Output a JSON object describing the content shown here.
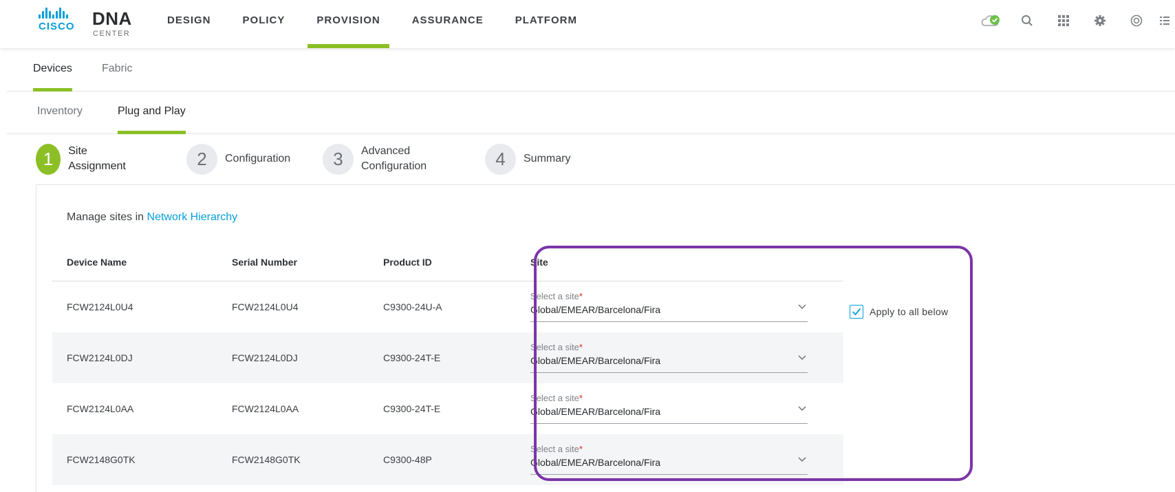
{
  "brand": {
    "cisco": "CISCO",
    "product": "DNA",
    "product_sub": "CENTER"
  },
  "top_nav": [
    {
      "label": "DESIGN",
      "active": false
    },
    {
      "label": "POLICY",
      "active": false
    },
    {
      "label": "PROVISION",
      "active": true
    },
    {
      "label": "ASSURANCE",
      "active": false
    },
    {
      "label": "PLATFORM",
      "active": false
    }
  ],
  "top_icons": [
    "cloud-status-icon",
    "search-icon",
    "apps-grid-icon",
    "settings-gear-icon",
    "help-globe-icon",
    "menu-list-icon"
  ],
  "tabs_primary": [
    {
      "label": "Devices",
      "active": true
    },
    {
      "label": "Fabric",
      "active": false
    }
  ],
  "tabs_secondary": [
    {
      "label": "Inventory",
      "active": false
    },
    {
      "label": "Plug and Play",
      "active": true
    }
  ],
  "steps": [
    {
      "num": "1",
      "label": "Site Assignment",
      "active": true
    },
    {
      "num": "2",
      "label": "Configuration",
      "active": false
    },
    {
      "num": "3",
      "label": "Advanced Configuration",
      "active": false
    },
    {
      "num": "4",
      "label": "Summary",
      "active": false
    }
  ],
  "manage": {
    "prefix": "Manage sites in",
    "link": "Network Hierarchy"
  },
  "table": {
    "headers": [
      "Device Name",
      "Serial Number",
      "Product ID",
      "Site"
    ],
    "rows": [
      {
        "device": "FCW2124L0U4",
        "serial": "FCW2124L0U4",
        "product": "C9300-24U-A",
        "site_placeholder": "Select a site",
        "site": "Global/EMEAR/Barcelona/Fira"
      },
      {
        "device": "FCW2124L0DJ",
        "serial": "FCW2124L0DJ",
        "product": "C9300-24T-E",
        "site_placeholder": "Select a site",
        "site": "Global/EMEAR/Barcelona/Fira"
      },
      {
        "device": "FCW2124L0AA",
        "serial": "FCW2124L0AA",
        "product": "C9300-24T-E",
        "site_placeholder": "Select a site",
        "site": "Global/EMEAR/Barcelona/Fira"
      },
      {
        "device": "FCW2148G0TK",
        "serial": "FCW2148G0TK",
        "product": "C9300-48P",
        "site_placeholder": "Select a site",
        "site": "Global/EMEAR/Barcelona/Fira"
      }
    ]
  },
  "apply_all": {
    "label": "Apply to all below",
    "checked": true
  },
  "colors": {
    "accent_green": "#8cbf26",
    "link_blue": "#049fd9",
    "highlight_purple": "#7b35a8",
    "required_red": "#e2231a"
  }
}
